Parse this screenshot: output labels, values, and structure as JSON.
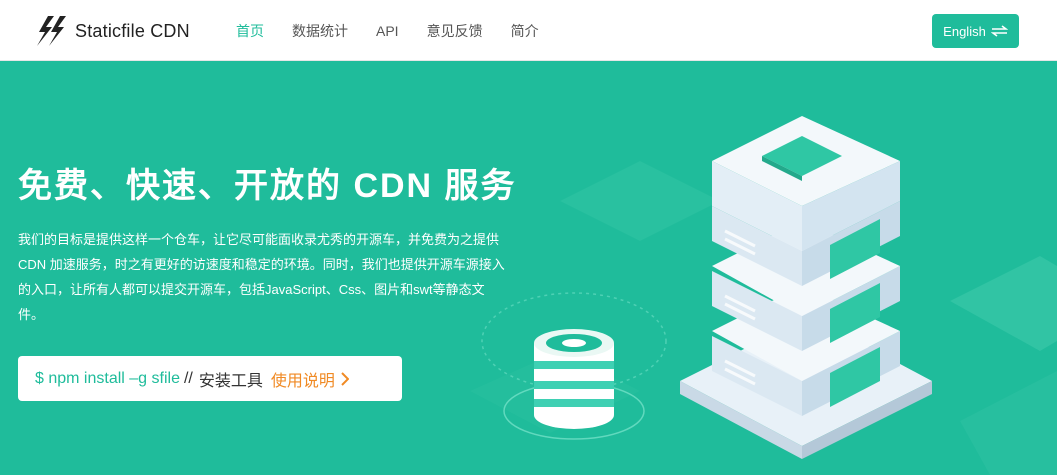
{
  "header": {
    "brand_name": "Staticfile CDN",
    "nav": [
      {
        "label": "首页",
        "active": true
      },
      {
        "label": "数据统计",
        "active": false
      },
      {
        "label": "API",
        "active": false
      },
      {
        "label": "意见反馈",
        "active": false
      },
      {
        "label": "简介",
        "active": false
      }
    ],
    "lang_button": "English",
    "lang_icon": "swap-arrows-icon"
  },
  "hero": {
    "title": "免费、快速、开放的 CDN 服务",
    "desc_line1": "我们的目标是提供这样一个仓车，让它尽可能面收录尤秀的开源车，并免费为之提供",
    "desc_line2": "CDN 加速服务，时之有更好的访速度和稳定的环境。同时，我们也提供开源车源接入",
    "desc_line3": "的入口，让所有人都可以提交开源车，包括JavaScript、Css、图片和swt等静态文",
    "desc_line4": "件。",
    "command": "$ npm install –g sfile",
    "separator": "//",
    "tool_label": "安装工具",
    "usage_link": "使用说明",
    "usage_icon": "chevron-right-icon"
  },
  "colors": {
    "accent": "#1fbc9b",
    "link_orange": "#f08a24"
  }
}
